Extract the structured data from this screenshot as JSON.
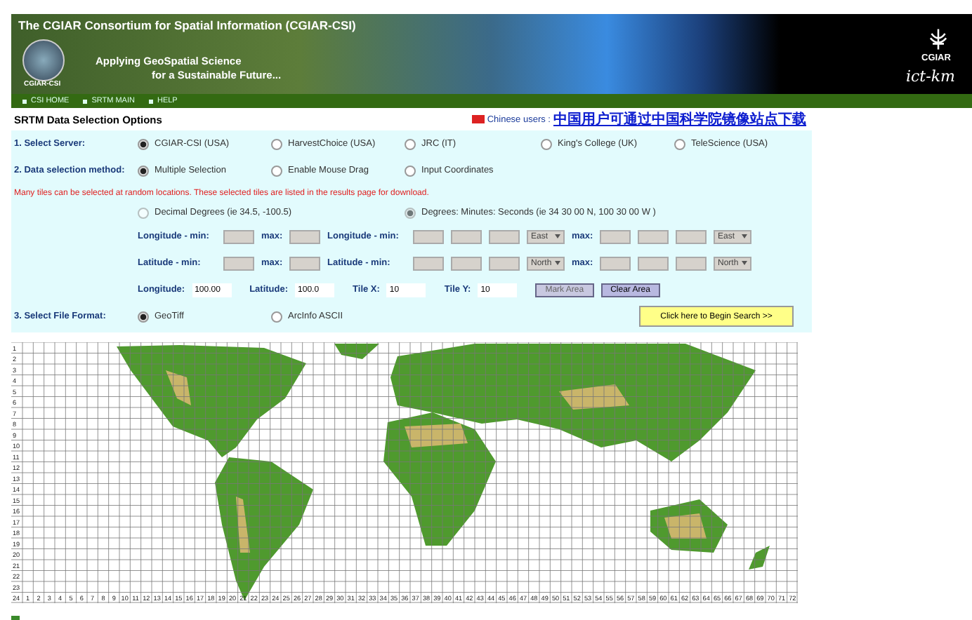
{
  "header": {
    "title": "The CGIAR Consortium for Spatial Information (CGIAR-CSI)",
    "tagline_1": "Applying GeoSpatial Science",
    "tagline_2": "for a Sustainable Future...",
    "logo_text": "CGIAR-CSI",
    "partner_name": "CGIAR",
    "partner_tag": "ict-km"
  },
  "nav": [
    "CSI HOME",
    "SRTM MAIN",
    "HELP"
  ],
  "page_title": "SRTM Data Selection Options",
  "chinese_notice": {
    "label": "Chinese users :",
    "link": "中国用户可通过中国科学院镜像站点下载"
  },
  "server": {
    "label": "1. Select Server:",
    "options": [
      {
        "label": "CGIAR-CSI (USA)",
        "selected": true
      },
      {
        "label": "HarvestChoice (USA)",
        "selected": false
      },
      {
        "label": "JRC (IT)",
        "selected": false
      },
      {
        "label": "King's College (UK)",
        "selected": false
      },
      {
        "label": "TeleScience (USA)",
        "selected": false
      }
    ]
  },
  "method": {
    "label": "2. Data selection method:",
    "options": [
      {
        "label": "Multiple Selection",
        "selected": true
      },
      {
        "label": "Enable Mouse Drag",
        "selected": false
      },
      {
        "label": "Input Coordinates",
        "selected": false
      }
    ]
  },
  "note": "Many tiles can be selected at random locations. These selected tiles are listed in the results page for download.",
  "coord_format": [
    {
      "label": "Decimal Degrees (ie 34.5, -100.5)",
      "selected": false
    },
    {
      "label": "Degrees: Minutes: Seconds (ie 34 30 00 N, 100 30 00 W )",
      "selected": true
    }
  ],
  "coord_rows": [
    {
      "decimal_label": "Longitude - min:",
      "decimal_max": "max:",
      "dms_label": "Longitude - min:",
      "dms_max": "max:",
      "direction_min": "East",
      "direction_max": "East"
    },
    {
      "decimal_label": "Latitude - min:",
      "decimal_max": "max:",
      "dms_label": "Latitude - min:",
      "dms_max": "max:",
      "direction_min": "North",
      "direction_max": "North"
    }
  ],
  "tile_fields": [
    {
      "label": "Longitude:",
      "value": "100.00"
    },
    {
      "label": "Latitude:",
      "value": "100.0"
    },
    {
      "label": "Tile X:",
      "value": "10"
    },
    {
      "label": "Tile Y:",
      "value": "10"
    }
  ],
  "tile_buttons": [
    {
      "label": "Mark Area",
      "disabled": true
    },
    {
      "label": "Clear Area",
      "disabled": false
    }
  ],
  "format": {
    "label": "3. Select File Format:",
    "options": [
      {
        "label": "GeoTiff",
        "selected": true
      },
      {
        "label": "ArcInfo ASCII",
        "selected": false
      }
    ]
  },
  "search_button": "Click here to Begin Search >>",
  "map": {
    "row_labels": [
      "1",
      "2",
      "3",
      "4",
      "5",
      "6",
      "7",
      "8",
      "9",
      "10",
      "11",
      "12",
      "13",
      "14",
      "15",
      "16",
      "17",
      "18",
      "19",
      "20",
      "21",
      "22",
      "23",
      "24"
    ],
    "column_labels": [
      "1",
      "2",
      "3",
      "4",
      "5",
      "6",
      "7",
      "8",
      "9",
      "10",
      "11",
      "12",
      "13",
      "14",
      "15",
      "16",
      "17",
      "18",
      "19",
      "20",
      "21",
      "22",
      "23",
      "24",
      "25",
      "26",
      "27",
      "28",
      "29",
      "30",
      "31",
      "32",
      "33",
      "34",
      "35",
      "36",
      "37",
      "38",
      "39",
      "40",
      "41",
      "42",
      "43",
      "44",
      "45",
      "46",
      "47",
      "48",
      "49",
      "50",
      "51",
      "52",
      "53",
      "54",
      "55",
      "56",
      "57",
      "58",
      "59",
      "60",
      "61",
      "62",
      "63",
      "64",
      "65",
      "66",
      "67",
      "68",
      "69",
      "70",
      "71",
      "72"
    ]
  }
}
